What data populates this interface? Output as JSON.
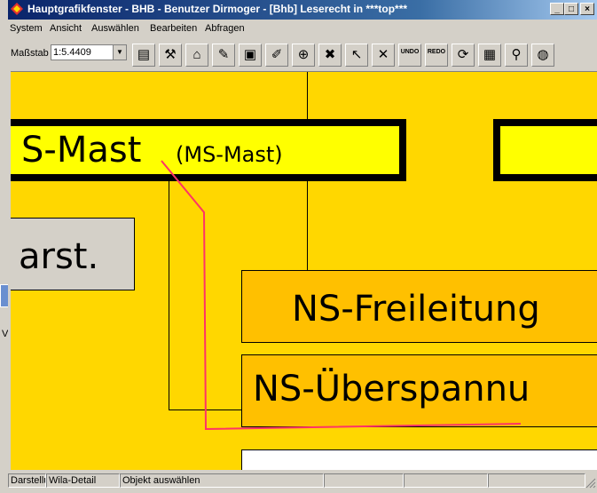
{
  "window": {
    "title": "Hauptgrafikfenster - BHB - Benutzer Dirmoger - [Bhb] Leserecht in ***top***",
    "controls": {
      "minimize": "_",
      "maximize": "□",
      "close": "×"
    }
  },
  "menu": {
    "items": [
      "System",
      "Ansicht",
      "Auswählen",
      "Bearbeiten",
      "Abfragen"
    ]
  },
  "toolbar": {
    "scale_label": "Maßstab",
    "scale_value": "1:5.4409",
    "buttons": [
      {
        "icon": "map-layers-icon",
        "glyph": "▤"
      },
      {
        "icon": "wrench-icon",
        "glyph": "⚒"
      },
      {
        "icon": "house-icon",
        "glyph": "⌂"
      },
      {
        "icon": "save-check-icon",
        "glyph": "✎"
      },
      {
        "icon": "monitor-icon",
        "glyph": "▣"
      },
      {
        "icon": "edit-pen-icon",
        "glyph": "✐"
      },
      {
        "icon": "add-object-icon",
        "glyph": "⊕"
      },
      {
        "icon": "delete-object-icon",
        "glyph": "✖"
      },
      {
        "icon": "pointer-icon",
        "glyph": "↖"
      },
      {
        "icon": "cancel-icon",
        "glyph": "✕"
      },
      {
        "icon": "undo-icon",
        "label": "UNDO"
      },
      {
        "icon": "redo-icon",
        "label": "REDO"
      },
      {
        "icon": "refresh-icon",
        "glyph": "⟳"
      },
      {
        "icon": "window-icon",
        "glyph": "▦"
      },
      {
        "icon": "zoom-icon",
        "glyph": "⚲"
      },
      {
        "icon": "globe-icon",
        "glyph": "◍"
      }
    ]
  },
  "canvas": {
    "mast_main": "S-Mast",
    "mast_sub": "(MS-Mast)",
    "grey_box": "arst.",
    "freileitung": "NS-Freileitung",
    "ueberspannung": "NS-Überspannu"
  },
  "statusbar": {
    "cells": [
      "Darstellu",
      "Wila-Detail",
      "Objekt auswählen",
      "",
      "",
      ""
    ]
  },
  "colors": {
    "canvas": "#ffd700",
    "mast_box": "#ffff00",
    "ns_box": "#ffc000",
    "red_line": "#ff3366"
  }
}
